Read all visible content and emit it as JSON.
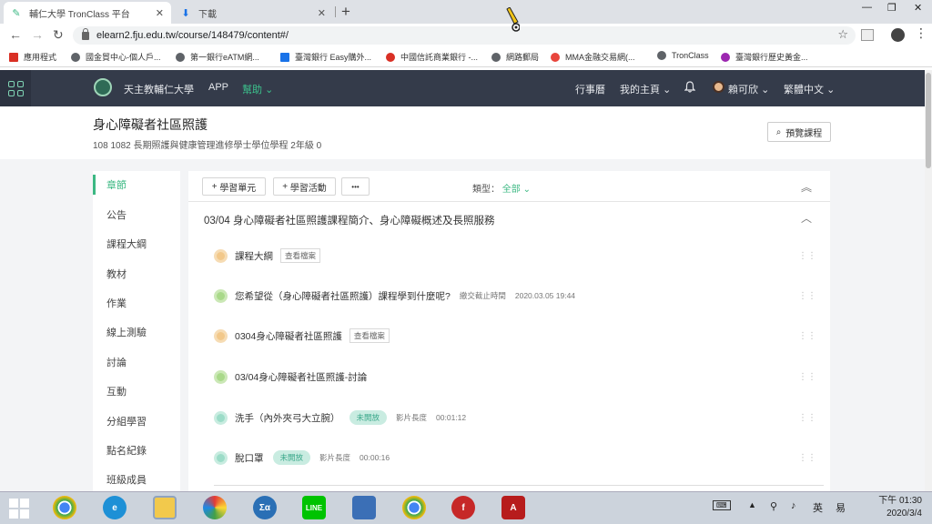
{
  "browser": {
    "tabs": [
      {
        "title": "輔仁大學 TronClass 平台",
        "icon": "tronclass-icon"
      },
      {
        "title": "下載",
        "icon": "download-icon"
      }
    ],
    "new_tab": "+",
    "url": "elearn2.fju.edu.tw/course/148479/content#/"
  },
  "bookmarks": [
    {
      "label": "應用程式",
      "icon": "apps-grid-icon",
      "color": "#d93025"
    },
    {
      "label": "國金貿中心-個人戶...",
      "icon": "globe-icon",
      "color": "#5f6368"
    },
    {
      "label": "第一銀行eATM網...",
      "icon": "globe-icon",
      "color": "#5f6368"
    },
    {
      "label": "臺灣銀行 Easy購外...",
      "icon": "bank-icon",
      "color": "#1a73e8"
    },
    {
      "label": "中國信託商業銀行 -...",
      "icon": "ctbc-icon",
      "color": "#d93025"
    },
    {
      "label": "網路郵局",
      "icon": "globe-icon",
      "color": "#5f6368"
    },
    {
      "label": "MMA金融交易網(...",
      "icon": "mma-icon",
      "color": "#e8453c"
    },
    {
      "label": "TronClass",
      "icon": "globe-icon",
      "color": "#5f6368"
    },
    {
      "label": "臺灣銀行歷史黃金...",
      "icon": "bot-icon",
      "color": "#9c27b0"
    }
  ],
  "header": {
    "school": "天主教輔仁大學",
    "app": "APP",
    "help": "幫助",
    "calendar": "行事曆",
    "my_home": "我的主頁",
    "user": "賴可欣",
    "language": "繁體中文"
  },
  "course": {
    "title": "身心障礙者社區照護",
    "subtitle": "108 1082 長期照護與健康管理進修學士學位學程 2年級 0",
    "preview_label": "預覽課程"
  },
  "sidebar": {
    "items": [
      "章節",
      "公告",
      "課程大綱",
      "教材",
      "作業",
      "線上測驗",
      "討論",
      "互動",
      "分組學習",
      "點名紀錄",
      "班級成員"
    ]
  },
  "toolbar": {
    "add_unit": "學習單元",
    "add_activity": "學習活動",
    "more": "•••",
    "filter_label": "類型：",
    "filter_value": "全部"
  },
  "section": {
    "title": "03/04 身心障礙者社區照護課程簡介、身心障礙概述及長照服務",
    "rows": [
      {
        "title": "課程大綱",
        "tag": "查看檔案",
        "color": "orange"
      },
      {
        "title": "您希望從（身心障礙者社區照護）課程學到什麼呢?",
        "meta": "繳交截止時間",
        "meta2": "2020.03.05 19:44",
        "color": "green"
      },
      {
        "title": "0304身心障礙者社區照護",
        "tag": "查看檔案",
        "color": "orange"
      },
      {
        "title": "03/04身心障礙者社區照護-討論",
        "color": "green"
      },
      {
        "title": "洗手（內外夾弓大立腕）",
        "status": "未開放",
        "meta": "影片長度",
        "meta2": "00:01:12",
        "color": "teal"
      },
      {
        "title": "脫口罩",
        "status": "未開放",
        "meta": "影片長度",
        "meta2": "00:00:16",
        "color": "teal"
      }
    ]
  },
  "taskbar": {
    "apps": [
      "start",
      "chrome",
      "ie",
      "file-explorer",
      "photos",
      "math",
      "line",
      "remote",
      "chrome",
      "flash",
      "acrobat"
    ],
    "tray_ime": "英",
    "tray_layout": "易",
    "time": "下午 01:30",
    "date": "2020/3/4"
  }
}
